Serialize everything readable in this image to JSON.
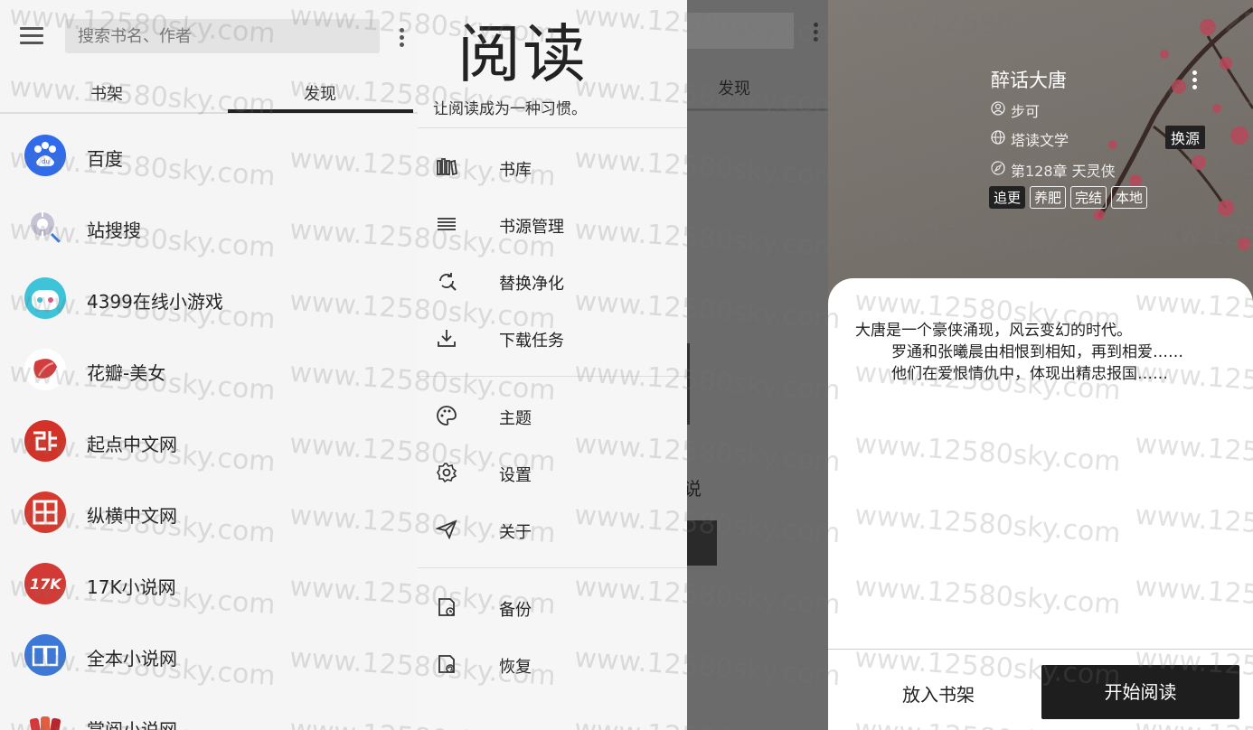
{
  "discover": {
    "search_placeholder": "搜索书名、作者",
    "tabs": [
      "书架",
      "发现"
    ],
    "sources": [
      {
        "label": "百度",
        "icon": "baidu-paw-icon"
      },
      {
        "label": "站搜搜",
        "icon": "magnifier-icon"
      },
      {
        "label": "4399在线小游戏",
        "icon": "game-robot-icon"
      },
      {
        "label": "花瓣-美女",
        "icon": "petal-icon"
      },
      {
        "label": "起点中文网",
        "icon": "qidian-logo-icon"
      },
      {
        "label": "纵横中文网",
        "icon": "zongheng-logo-icon"
      },
      {
        "label": "17K小说网",
        "icon": "17k-logo-icon"
      },
      {
        "label": "全本小说网",
        "icon": "open-book-icon"
      },
      {
        "label": "掌阅小说网",
        "icon": "zhangyue-logo-icon"
      }
    ]
  },
  "drawer": {
    "brand": "阅读",
    "slogan": "让阅读成为一种习惯。",
    "items": [
      {
        "label": "书库",
        "icon": "library-icon"
      },
      {
        "label": "书源管理",
        "icon": "list-icon"
      },
      {
        "label": "替换净化",
        "icon": "replace-search-icon"
      },
      {
        "label": "下载任务",
        "icon": "download-icon"
      },
      {
        "label": "主题",
        "icon": "palette-icon"
      },
      {
        "label": "设置",
        "icon": "gear-icon"
      },
      {
        "label": "关于",
        "icon": "paper-plane-icon"
      },
      {
        "label": "备份",
        "icon": "backup-icon"
      },
      {
        "label": "恢复",
        "icon": "restore-icon"
      }
    ]
  },
  "peek": {
    "tab": "发现",
    "text": "说"
  },
  "book": {
    "title": "醉话大唐",
    "author": "步可",
    "source": "塔读文学",
    "swap_label": "换源",
    "chapter": "第128章 天灵侠",
    "tags": [
      "追更",
      "养肥",
      "完结",
      "本地"
    ],
    "intro": [
      "大唐是一个豪侠涌现，风云变幻的时代。",
      "罗通和张曦晨由相恨到相知，再到相爱……",
      "他们在爱恨情仇中，体现出精忠报国……"
    ],
    "add_shelf_label": "放入书架",
    "start_read_label": "开始阅读"
  },
  "watermark": "www.12580sky.com",
  "colors": {
    "accent": "#222222",
    "baidu": "#2f6bea",
    "qidian": "#d23228",
    "zongheng": "#d63a2f",
    "k17": "#d33a35",
    "quanben": "#3b78d8",
    "petal": "#d43d3d"
  }
}
